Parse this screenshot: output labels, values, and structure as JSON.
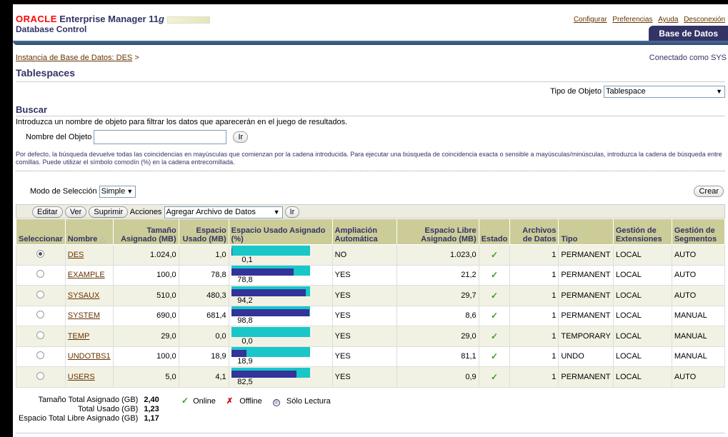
{
  "header": {
    "brand": "ORACLE",
    "product": "Enterprise Manager 11",
    "product_g": "g",
    "subtitle": "Database Control",
    "links": [
      "Configurar",
      "Preferencias",
      "Ayuda",
      "Desconexión"
    ],
    "tab": "Base de Datos"
  },
  "breadcrumb": {
    "link": "Instancia de Base de Datos: DES",
    "sep": ">",
    "connected": "Conectado como SYS"
  },
  "page_title": "Tablespaces",
  "object_type": {
    "label": "Tipo de Objeto",
    "value": "Tablespace"
  },
  "search": {
    "title": "Buscar",
    "intro": "Introduzca un nombre de objeto para filtrar los datos que aparecerán en el juego de resultados.",
    "name_label": "Nombre del Objeto",
    "name_value": "",
    "go": "Ir",
    "help": "Por defecto, la búsqueda devuelve todas las coincidencias en mayúsculas que comienzan por la cadena introducida. Para ejecutar una búsqueda de coincidencia exacta o sensible a mayúsculas/minúsculas, introduzca la cadena de búsqueda entre comillas. Puede utilizar el símbolo comodín (%) en la cadena entrecomillada."
  },
  "selection": {
    "label": "Modo de Selección",
    "value": "Simple"
  },
  "create": "Crear",
  "toolbar": {
    "edit": "Editar",
    "view": "Ver",
    "delete": "Suprimir",
    "actions_label": "Acciones",
    "actions_value": "Agregar Archivo de Datos",
    "go": "Ir"
  },
  "columns": {
    "select": "Seleccionar",
    "name": "Nombre",
    "alloc": "Tamaño Asignado (MB)",
    "used": "Espacio Usado (MB)",
    "used_pct": "Espacio Usado Asignado (%)",
    "autoext": "Ampliación Automática",
    "free": "Espacio Libre Asignado (MB)",
    "status": "Estado",
    "files": "Archivos de Datos",
    "type": "Tipo",
    "ext": "Gestión de Extensiones",
    "seg": "Gestión de Segmentos"
  },
  "rows": [
    {
      "selected": true,
      "name": "DES",
      "alloc": "1.024,0",
      "used": "1,0",
      "pct": 0.1,
      "pct_label": "0,1",
      "autoext": "NO",
      "free": "1.023,0",
      "files": "1",
      "type": "PERMANENT",
      "ext": "LOCAL",
      "seg": "AUTO"
    },
    {
      "selected": false,
      "name": "EXAMPLE",
      "alloc": "100,0",
      "used": "78,8",
      "pct": 78.8,
      "pct_label": "78,8",
      "autoext": "YES",
      "free": "21,2",
      "files": "1",
      "type": "PERMANENT",
      "ext": "LOCAL",
      "seg": "AUTO"
    },
    {
      "selected": false,
      "name": "SYSAUX",
      "alloc": "510,0",
      "used": "480,3",
      "pct": 94.2,
      "pct_label": "94,2",
      "autoext": "YES",
      "free": "29,7",
      "files": "1",
      "type": "PERMANENT",
      "ext": "LOCAL",
      "seg": "AUTO"
    },
    {
      "selected": false,
      "name": "SYSTEM",
      "alloc": "690,0",
      "used": "681,4",
      "pct": 98.8,
      "pct_label": "98,8",
      "autoext": "YES",
      "free": "8,6",
      "files": "1",
      "type": "PERMANENT",
      "ext": "LOCAL",
      "seg": "MANUAL"
    },
    {
      "selected": false,
      "name": "TEMP",
      "alloc": "29,0",
      "used": "0,0",
      "pct": 0.0,
      "pct_label": "0,0",
      "autoext": "YES",
      "free": "29,0",
      "files": "1",
      "type": "TEMPORARY",
      "ext": "LOCAL",
      "seg": "MANUAL"
    },
    {
      "selected": false,
      "name": "UNDOTBS1",
      "alloc": "100,0",
      "used": "18,9",
      "pct": 18.9,
      "pct_label": "18,9",
      "autoext": "YES",
      "free": "81,1",
      "files": "1",
      "type": "UNDO",
      "ext": "LOCAL",
      "seg": "MANUAL"
    },
    {
      "selected": false,
      "name": "USERS",
      "alloc": "5,0",
      "used": "4,1",
      "pct": 82.5,
      "pct_label": "82,5",
      "autoext": "YES",
      "free": "0,9",
      "files": "1",
      "type": "PERMANENT",
      "ext": "LOCAL",
      "seg": "AUTO"
    }
  ],
  "totals": [
    {
      "label": "Tamaño Total Asignado (GB)",
      "value": "2,40"
    },
    {
      "label": "Total Usado (GB)",
      "value": "1,23"
    },
    {
      "label": "Espacio Total Libre Asignado (GB)",
      "value": "1,17"
    }
  ],
  "legend": {
    "online": "Online",
    "offline": "Offline",
    "readonly": "Sólo Lectura"
  },
  "colors": {
    "bar_bg": "#19c7c9",
    "bar_fill": "#333399",
    "header_bg": "#cccc99",
    "header_text": "#336",
    "alt_row": "#f2f2e4"
  }
}
